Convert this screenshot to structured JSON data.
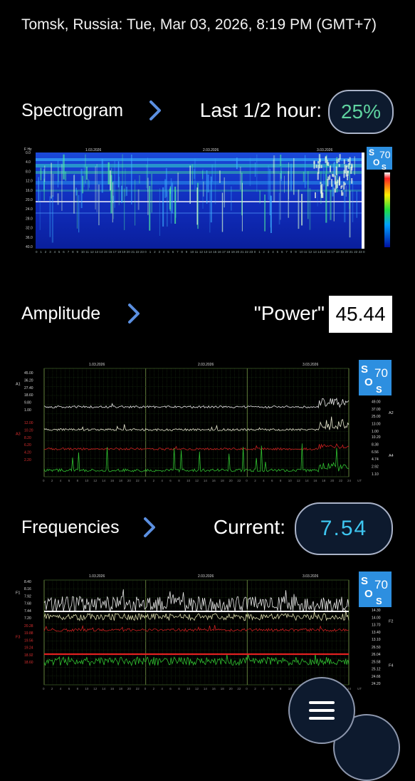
{
  "header": {
    "title": "Tomsk, Russia: Tue, Mar 03, 2026, 8:19 PM (GMT+7)"
  },
  "spectrogram": {
    "label": "Spectrogram",
    "caption": "Last 1/2 hour:",
    "value": "25%"
  },
  "amplitude": {
    "label": "Amplitude",
    "caption": "\"Power\"",
    "value": "45.44"
  },
  "frequencies": {
    "label": "Frequencies",
    "caption": "Current:",
    "value": "7.54"
  },
  "logo": {
    "line1": "S",
    "line2": "70",
    "line3": "O",
    "line4": "S"
  },
  "dates": [
    "1.03.2026",
    "2.03.2026",
    "3.03.2026"
  ],
  "spec_yticks": [
    "0.0",
    "4.0",
    "8.0",
    "12.0",
    "16.0",
    "20.0",
    "24.0",
    "28.0",
    "32.0",
    "36.0",
    "40.0"
  ],
  "spec_yunit": "F Hz",
  "amp_left_ticks_a1": [
    "45.00",
    "36.20",
    "27.40",
    "18.60",
    "9.80",
    "1.00"
  ],
  "amp_left_ticks_a3": [
    "12.00",
    "10.20",
    "8.20",
    "6.20",
    "4.20",
    "2.20"
  ],
  "amp_right_ticks_a2": [
    "61.00",
    "49.00",
    "37.00",
    "25.00",
    "13.00",
    "1.00"
  ],
  "amp_right_ticks_a4": [
    "10.20",
    "8.38",
    "6.56",
    "4.74",
    "2.92",
    "1.10"
  ],
  "amp_series_labels": {
    "a1": "A1",
    "a2": "A2",
    "a3": "A3",
    "a4": "A4"
  },
  "freq_left_ticks_f1": [
    "8.40",
    "8.16",
    "7.92",
    "7.68",
    "7.44",
    "7.20"
  ],
  "freq_left_ticks_f3": [
    "20.28",
    "19.88",
    "19.56",
    "19.24",
    "18.92",
    "18.60"
  ],
  "freq_right_ticks_f2": [
    "14.60",
    "14.30",
    "14.00",
    "13.70",
    "13.40",
    "13.10"
  ],
  "freq_right_ticks_f4": [
    "26.50",
    "26.04",
    "25.58",
    "25.12",
    "24.66",
    "24.20"
  ],
  "freq_series_labels": {
    "f1": "F1",
    "f2": "F2",
    "f3": "F3",
    "f4": "F4"
  },
  "hour_ticks": [
    "0",
    "2",
    "4",
    "6",
    "8",
    "10",
    "12",
    "14",
    "16",
    "18",
    "20",
    "22",
    "0",
    "2",
    "4",
    "6",
    "8",
    "10",
    "12",
    "14",
    "16",
    "18",
    "20",
    "22",
    "0",
    "2",
    "4",
    "6",
    "8",
    "10",
    "12",
    "14",
    "16",
    "18",
    "20",
    "22",
    "24"
  ],
  "hour_unit": "UT",
  "colors": {
    "accent_chevron": "#5b8fe0",
    "pill_value": "#5fd3a0",
    "current_value": "#3ec6f0",
    "logo_bg": "#2d8fe0"
  },
  "icons": {
    "chevron": "chevron-right-icon",
    "menu": "menu-icon"
  }
}
